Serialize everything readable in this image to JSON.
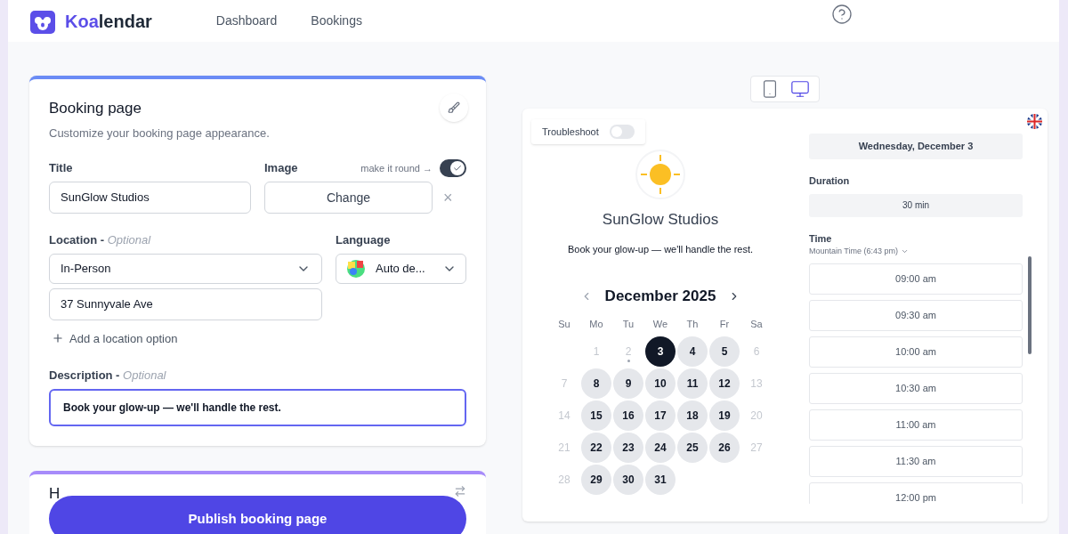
{
  "header": {
    "logo": {
      "accent": "Koa",
      "rest": "lendar"
    },
    "nav": [
      {
        "label": "Dashboard",
        "selected": false
      },
      {
        "label": "Bookings",
        "selected": false
      }
    ]
  },
  "booking_card": {
    "title": "Booking page",
    "subtitle": "Customize your booking page appearance.",
    "title_field": {
      "label": "Title",
      "value": "SunGlow Studios"
    },
    "image": {
      "label": "Image",
      "round_label": "make it round →",
      "round_on": true,
      "button": "Change",
      "remove": "×"
    },
    "location": {
      "label": "Location - ",
      "optional": "Optional",
      "value": "In-Person",
      "address": "37 Sunnyvale Ave",
      "add": "Add a location option"
    },
    "language": {
      "label": "Language",
      "value": "Auto de..."
    },
    "description": {
      "label": "Description - ",
      "optional": "Optional",
      "value": "Book your glow-up — we'll handle the rest."
    }
  },
  "hosts_card": {
    "title": "H"
  },
  "publish_button": "Publish booking page",
  "device_toggle": [
    {
      "kind": "mobile",
      "selected": false
    },
    {
      "kind": "desktop",
      "selected": true
    }
  ],
  "preview": {
    "troubleshoot": {
      "label": "Troubleshoot",
      "on": false
    },
    "name": "SunGlow Studios",
    "tagline": "Book your glow-up — we'll handle the rest.",
    "month": "December 2025",
    "weekdays": [
      "Su",
      "Mo",
      "Tu",
      "We",
      "Th",
      "Fr",
      "Sa"
    ],
    "weeks": [
      [
        {
          "day": "1",
          "available": false,
          "selected": false,
          "today": false
        },
        {
          "day": "2",
          "available": false,
          "selected": false,
          "today": true
        },
        {
          "day": "3",
          "available": true,
          "selected": true,
          "today": false
        },
        {
          "day": "4",
          "available": true,
          "selected": false,
          "today": false
        },
        {
          "day": "5",
          "available": true,
          "selected": false,
          "today": false
        },
        {
          "day": "6",
          "available": false,
          "selected": false,
          "today": false
        }
      ],
      [
        {
          "day": "7",
          "available": false,
          "selected": false,
          "today": false
        },
        {
          "day": "8",
          "available": true,
          "selected": false,
          "today": false
        },
        {
          "day": "9",
          "available": true,
          "selected": false,
          "today": false
        },
        {
          "day": "10",
          "available": true,
          "selected": false,
          "today": false
        },
        {
          "day": "11",
          "available": true,
          "selected": false,
          "today": false
        },
        {
          "day": "12",
          "available": true,
          "selected": false,
          "today": false
        },
        {
          "day": "13",
          "available": false,
          "selected": false,
          "today": false
        }
      ],
      [
        {
          "day": "14",
          "available": false,
          "selected": false,
          "today": false
        },
        {
          "day": "15",
          "available": true,
          "selected": false,
          "today": false
        },
        {
          "day": "16",
          "available": true,
          "selected": false,
          "today": false
        },
        {
          "day": "17",
          "available": true,
          "selected": false,
          "today": false
        },
        {
          "day": "18",
          "available": true,
          "selected": false,
          "today": false
        },
        {
          "day": "19",
          "available": true,
          "selected": false,
          "today": false
        },
        {
          "day": "20",
          "available": false,
          "selected": false,
          "today": false
        }
      ],
      [
        {
          "day": "21",
          "available": false,
          "selected": false,
          "today": false
        },
        {
          "day": "22",
          "available": true,
          "selected": false,
          "today": false
        },
        {
          "day": "23",
          "available": true,
          "selected": false,
          "today": false
        },
        {
          "day": "24",
          "available": true,
          "selected": false,
          "today": false
        },
        {
          "day": "25",
          "available": true,
          "selected": false,
          "today": false
        },
        {
          "day": "26",
          "available": true,
          "selected": false,
          "today": false
        },
        {
          "day": "27",
          "available": false,
          "selected": false,
          "today": false
        }
      ],
      [
        {
          "day": "28",
          "available": false,
          "selected": false,
          "today": false
        },
        {
          "day": "29",
          "available": true,
          "selected": false,
          "today": false
        },
        {
          "day": "30",
          "available": true,
          "selected": false,
          "today": false
        },
        {
          "day": "31",
          "available": true,
          "selected": false,
          "today": false
        }
      ]
    ],
    "date": "Wednesday, December 3",
    "duration_label": "Duration",
    "duration": "30 min",
    "time_label": "Time",
    "timezone": "Mountain Time (6:43 pm)",
    "slots": [
      "09:00 am",
      "09:30 am",
      "10:00 am",
      "10:30 am",
      "11:00 am",
      "11:30 am",
      "12:00 pm"
    ]
  }
}
